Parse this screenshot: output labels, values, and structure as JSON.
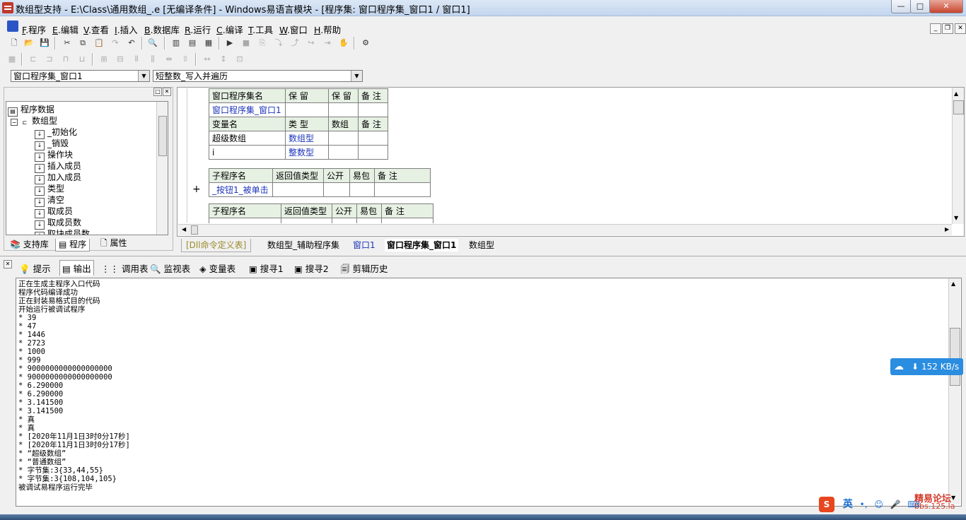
{
  "window": {
    "title": "数组型支持 - E:\\Class\\通用数组_.e [无编译条件] - Windows易语言模块 - [程序集: 窗口程序集_窗口1 / 窗口1]",
    "min_label": "—",
    "max_label": "□",
    "close_label": "✕"
  },
  "menu": {
    "items": [
      {
        "key": "F",
        "label": ".程序"
      },
      {
        "key": "E",
        "label": ".编辑"
      },
      {
        "key": "V",
        "label": ".查看"
      },
      {
        "key": "I",
        "label": ".插入"
      },
      {
        "key": "B",
        "label": ".数据库"
      },
      {
        "key": "R",
        "label": ".运行"
      },
      {
        "key": "C",
        "label": ".编译"
      },
      {
        "key": "T",
        "label": ".工具"
      },
      {
        "key": "W",
        "label": ".窗口"
      },
      {
        "key": "H",
        "label": ".帮助"
      }
    ],
    "mdi_min": "_",
    "mdi_restore": "❐",
    "mdi_close": "✕"
  },
  "toolbar": {
    "combo_left": "窗口程序集_窗口1",
    "combo_right": "短整数_写入并遍历"
  },
  "left_panel": {
    "tree": [
      {
        "label": "程序数据",
        "level": 0,
        "icon": "database-icon"
      },
      {
        "label": "数组型",
        "level": 1,
        "icon": "class-icon"
      },
      {
        "label": "_初始化",
        "level": 2,
        "icon": "method-icon"
      },
      {
        "label": "_销毁",
        "level": 2,
        "icon": "method-icon"
      },
      {
        "label": "操作块",
        "level": 2,
        "icon": "method-icon"
      },
      {
        "label": "插入成员",
        "level": 2,
        "icon": "method-icon"
      },
      {
        "label": "加入成员",
        "level": 2,
        "icon": "method-icon"
      },
      {
        "label": "类型",
        "level": 2,
        "icon": "method-icon"
      },
      {
        "label": "清空",
        "level": 2,
        "icon": "method-icon"
      },
      {
        "label": "取成员",
        "level": 2,
        "icon": "method-icon"
      },
      {
        "label": "取成员数",
        "level": 2,
        "icon": "method-icon"
      },
      {
        "label": "取块成员数",
        "level": 2,
        "icon": "method-icon"
      }
    ],
    "tabs": [
      "支持库",
      "程序",
      "属性"
    ]
  },
  "code": {
    "assembly_table": {
      "headers": [
        "窗口程序集名",
        "保 留",
        "保 留",
        "备 注"
      ],
      "row": [
        "窗口程序集_窗口1",
        "",
        "",
        ""
      ],
      "var_headers": [
        "变量名",
        "类 型",
        "数组",
        "备 注"
      ],
      "vars": [
        [
          "超级数组",
          "数组型",
          "",
          ""
        ],
        [
          "i",
          "整数型",
          "",
          ""
        ]
      ]
    },
    "sub1": {
      "headers": [
        "子程序名",
        "返回值类型",
        "公开",
        "易包",
        "备 注"
      ],
      "row": [
        "_按钮1_被单击",
        "",
        "",
        "",
        ""
      ],
      "expand": "+"
    },
    "sub2": {
      "headers": [
        "子程序名",
        "返回值类型",
        "公开",
        "易包",
        "备 注"
      ]
    }
  },
  "editor_tabs": [
    "[Dll命令定义表]",
    "数组型_辅助程序集",
    "窗口1",
    "窗口程序集_窗口1",
    "数组型"
  ],
  "output_tabs": [
    "提示",
    "输出",
    "调用表",
    "监视表",
    "变量表",
    "搜寻1",
    "搜寻2",
    "剪辑历史"
  ],
  "output_lines": [
    "正在生成主程序入口代码",
    "程序代码编译成功",
    "正在封装易格式目的代码",
    "开始运行被调试程序",
    "* 39",
    "* 47",
    "* 1446",
    "* 2723",
    "* 1000",
    "* 999",
    "* 9000000000000000000",
    "* 9000000000000000000",
    "* 6.290000",
    "* 6.290000",
    "* 3.141500",
    "* 3.141500",
    "* 真",
    "* 真",
    "* [2020年11月1日3时0分17秒]",
    "* [2020年11月1日3时0分17秒]",
    "* “超级数组”",
    "* “普通数组”",
    "* 字节集:3{33,44,55}",
    "* 字节集:3{108,104,105}",
    "被调试易程序运行完毕"
  ],
  "net_widget": {
    "speed": "152 KB/s"
  },
  "watermark": {
    "line1": "精易论坛",
    "line2": "bbs.125.la"
  },
  "ime": {
    "lang": "英"
  }
}
